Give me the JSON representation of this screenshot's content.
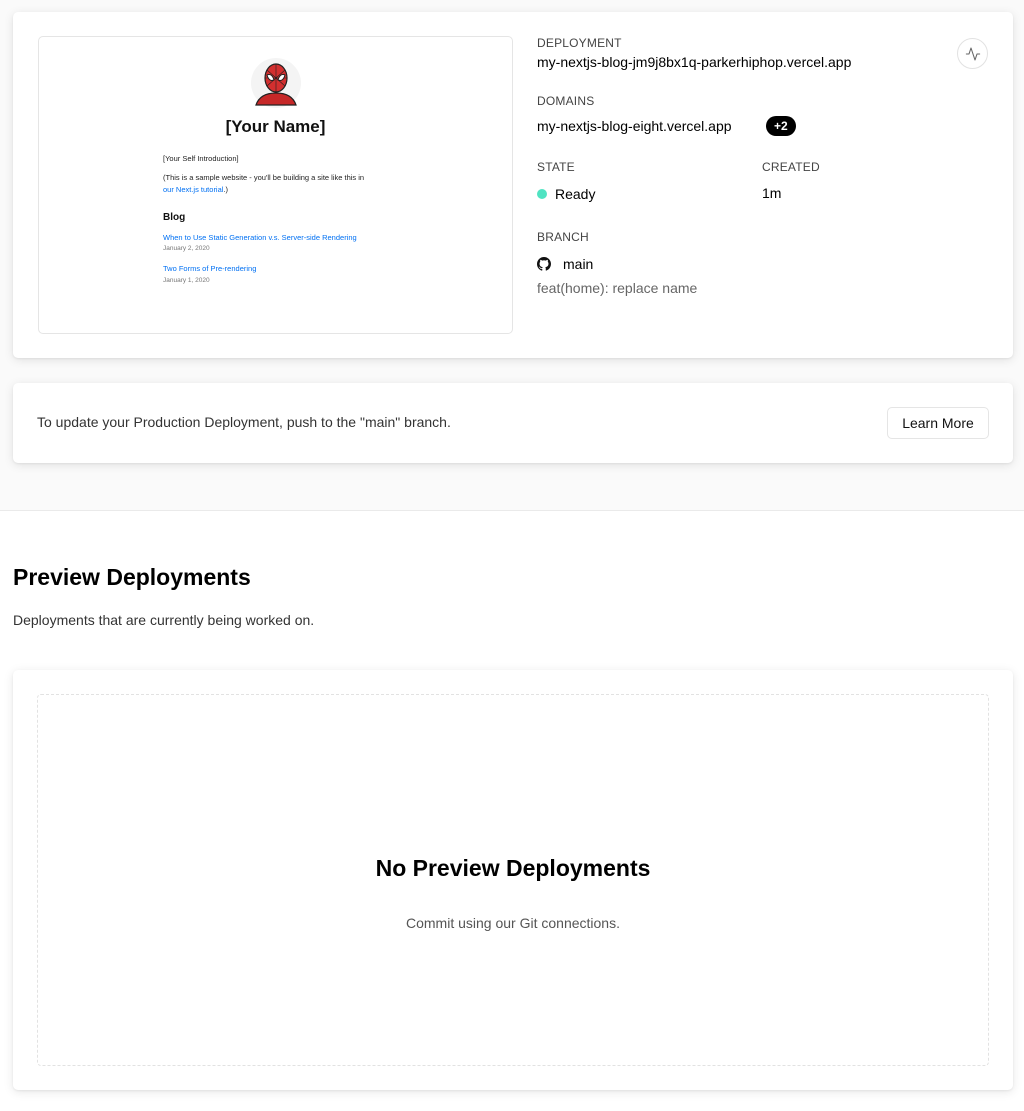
{
  "production": {
    "preview": {
      "name": "[Your Name]",
      "intro": "[Your Self Introduction]",
      "sample_text": "(This is a sample website - you'll be building a site like this in",
      "sample_link": "our Next.js tutorial",
      "sample_end": ".)",
      "blog_heading": "Blog",
      "posts": [
        {
          "title": "When to Use Static Generation v.s. Server-side Rendering",
          "date": "January 2, 2020"
        },
        {
          "title": "Two Forms of Pre-rendering",
          "date": "January 1, 2020"
        }
      ]
    },
    "deployment_label": "DEPLOYMENT",
    "deployment_url": "my-nextjs-blog-jm9j8bx1q-parkerhiphop.vercel.app",
    "domains_label": "DOMAINS",
    "domain": "my-nextjs-blog-eight.vercel.app",
    "domains_extra": "+2",
    "state_label": "STATE",
    "state_value": "Ready",
    "created_label": "CREATED",
    "created_value": "1m",
    "branch_label": "BRANCH",
    "branch_value": "main",
    "commit_message": "feat(home): replace name",
    "status_color": "#50e3c2",
    "activity_icon": "activity-icon"
  },
  "update_notice": {
    "text": "To update your Production Deployment, push to the \"main\" branch.",
    "button": "Learn More"
  },
  "preview_section": {
    "title": "Preview Deployments",
    "description": "Deployments that are currently being worked on.",
    "empty_title": "No Preview Deployments",
    "empty_description": "Commit using our Git connections."
  }
}
